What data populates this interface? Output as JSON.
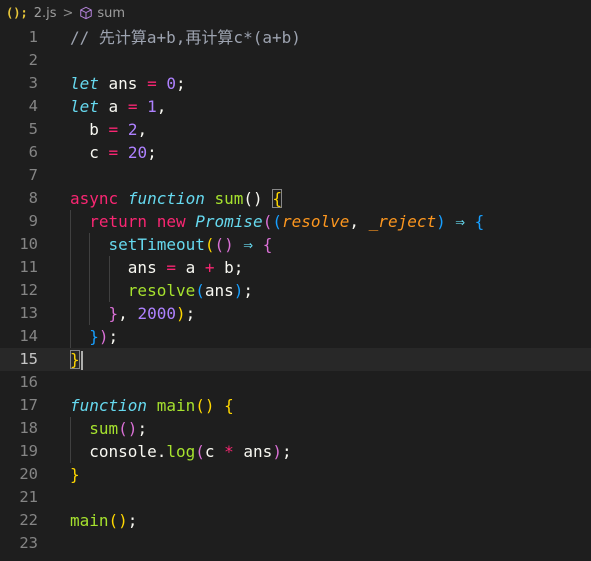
{
  "breadcrumb": {
    "file_icon": "();",
    "file_name": "2.js",
    "separator": ">",
    "symbol_icon": "cube-icon",
    "symbol_name": "sum"
  },
  "colors": {
    "background": "#1e1e1e",
    "current_line": "#282828",
    "comment": "#9da3b0",
    "keyword_italic": "#66d9ef",
    "keyword_pink": "#f92672",
    "function": "#a6e22e",
    "number": "#ae81ff",
    "param": "#fd971f",
    "text": "#f8f8f2",
    "bracket_gold": "#ffd700",
    "bracket_pink": "#da70d6",
    "bracket_blue": "#179fff"
  },
  "editor": {
    "active_line": 15,
    "lines": [
      {
        "num": "1",
        "indent": 0,
        "tokens": [
          [
            "comment",
            "// 先计算a+b,再计算c*(a+b)"
          ]
        ]
      },
      {
        "num": "2",
        "indent": 0,
        "tokens": []
      },
      {
        "num": "3",
        "indent": 0,
        "tokens": [
          [
            "kwi",
            "let"
          ],
          [
            "txt",
            " ans "
          ],
          [
            "op",
            "="
          ],
          [
            "txt",
            " "
          ],
          [
            "num",
            "0"
          ],
          [
            "txt",
            ";"
          ]
        ]
      },
      {
        "num": "4",
        "indent": 0,
        "tokens": [
          [
            "kwi",
            "let"
          ],
          [
            "txt",
            " a "
          ],
          [
            "op",
            "="
          ],
          [
            "txt",
            " "
          ],
          [
            "num",
            "1"
          ],
          [
            "txt",
            ","
          ]
        ]
      },
      {
        "num": "5",
        "indent": 0,
        "tokens": [
          [
            "txt",
            "  b "
          ],
          [
            "op",
            "="
          ],
          [
            "txt",
            " "
          ],
          [
            "num",
            "2"
          ],
          [
            "txt",
            ","
          ]
        ]
      },
      {
        "num": "6",
        "indent": 0,
        "tokens": [
          [
            "txt",
            "  c "
          ],
          [
            "op",
            "="
          ],
          [
            "txt",
            " "
          ],
          [
            "num",
            "20"
          ],
          [
            "txt",
            ";"
          ]
        ]
      },
      {
        "num": "7",
        "indent": 0,
        "tokens": []
      },
      {
        "num": "8",
        "indent": 0,
        "tokens": [
          [
            "kw",
            "async"
          ],
          [
            "txt",
            " "
          ],
          [
            "kwi",
            "function"
          ],
          [
            "txt",
            " "
          ],
          [
            "fn",
            "sum"
          ],
          [
            "txt",
            "() "
          ],
          [
            "b1box",
            "{"
          ]
        ]
      },
      {
        "num": "9",
        "indent": 1,
        "tokens": [
          [
            "txt",
            "  "
          ],
          [
            "kw",
            "return"
          ],
          [
            "txt",
            " "
          ],
          [
            "kw",
            "new"
          ],
          [
            "txt",
            " "
          ],
          [
            "cls",
            "Promise"
          ],
          [
            "b2",
            "("
          ],
          [
            "b3",
            "("
          ],
          [
            "param",
            "resolve"
          ],
          [
            "txt",
            ", "
          ],
          [
            "param",
            "_reject"
          ],
          [
            "b3",
            ")"
          ],
          [
            "txt",
            " "
          ],
          [
            "arrow",
            "⇒"
          ],
          [
            "txt",
            " "
          ],
          [
            "b3",
            "{"
          ]
        ]
      },
      {
        "num": "10",
        "indent": 2,
        "tokens": [
          [
            "txt",
            "    "
          ],
          [
            "fn2",
            "setTimeout"
          ],
          [
            "b1",
            "("
          ],
          [
            "b2",
            "()"
          ],
          [
            "txt",
            " "
          ],
          [
            "arrow",
            "⇒"
          ],
          [
            "txt",
            " "
          ],
          [
            "b2",
            "{"
          ]
        ]
      },
      {
        "num": "11",
        "indent": 3,
        "tokens": [
          [
            "txt",
            "      ans "
          ],
          [
            "op",
            "="
          ],
          [
            "txt",
            " a "
          ],
          [
            "op",
            "+"
          ],
          [
            "txt",
            " b;"
          ]
        ]
      },
      {
        "num": "12",
        "indent": 3,
        "tokens": [
          [
            "txt",
            "      "
          ],
          [
            "fn",
            "resolve"
          ],
          [
            "b3",
            "("
          ],
          [
            "txt",
            "ans"
          ],
          [
            "b3",
            ")"
          ],
          [
            "txt",
            ";"
          ]
        ]
      },
      {
        "num": "13",
        "indent": 2,
        "tokens": [
          [
            "txt",
            "    "
          ],
          [
            "b2",
            "}"
          ],
          [
            "txt",
            ", "
          ],
          [
            "num",
            "2000"
          ],
          [
            "b1",
            ")"
          ],
          [
            "txt",
            ";"
          ]
        ]
      },
      {
        "num": "14",
        "indent": 1,
        "tokens": [
          [
            "txt",
            "  "
          ],
          [
            "b3",
            "}"
          ],
          [
            "b2",
            ")"
          ],
          [
            "txt",
            ";"
          ]
        ]
      },
      {
        "num": "15",
        "indent": 0,
        "tokens": [
          [
            "b1box",
            "}"
          ],
          [
            "cursor",
            ""
          ]
        ]
      },
      {
        "num": "16",
        "indent": 0,
        "tokens": []
      },
      {
        "num": "17",
        "indent": 0,
        "tokens": [
          [
            "kwi",
            "function"
          ],
          [
            "txt",
            " "
          ],
          [
            "fn",
            "main"
          ],
          [
            "b1",
            "()"
          ],
          [
            "txt",
            " "
          ],
          [
            "b1",
            "{"
          ]
        ]
      },
      {
        "num": "18",
        "indent": 1,
        "tokens": [
          [
            "txt",
            "  "
          ],
          [
            "fn",
            "sum"
          ],
          [
            "b2",
            "()"
          ],
          [
            "txt",
            ";"
          ]
        ]
      },
      {
        "num": "19",
        "indent": 1,
        "tokens": [
          [
            "txt",
            "  console."
          ],
          [
            "fn",
            "log"
          ],
          [
            "b2",
            "("
          ],
          [
            "txt",
            "c "
          ],
          [
            "op",
            "*"
          ],
          [
            "txt",
            " ans"
          ],
          [
            "b2",
            ")"
          ],
          [
            "txt",
            ";"
          ]
        ]
      },
      {
        "num": "20",
        "indent": 0,
        "tokens": [
          [
            "b1",
            "}"
          ]
        ]
      },
      {
        "num": "21",
        "indent": 0,
        "tokens": []
      },
      {
        "num": "22",
        "indent": 0,
        "tokens": [
          [
            "fn",
            "main"
          ],
          [
            "b1",
            "()"
          ],
          [
            "txt",
            ";"
          ]
        ]
      },
      {
        "num": "23",
        "indent": 0,
        "tokens": []
      }
    ]
  }
}
